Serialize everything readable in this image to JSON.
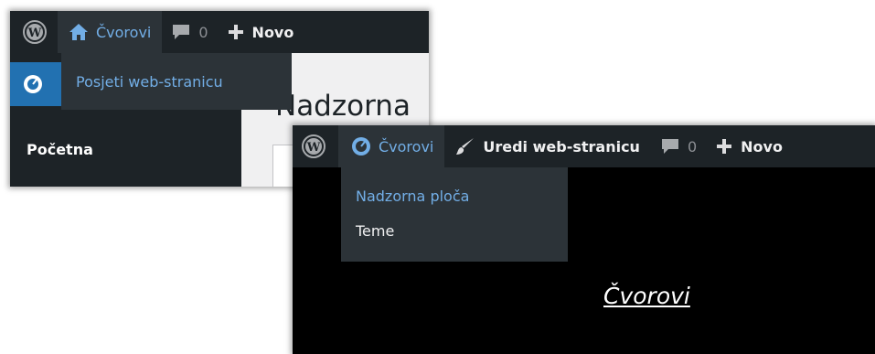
{
  "screenshot1": {
    "adminbar": {
      "site_name": "Čvorovi",
      "comments_count": "0",
      "new_label": "Novo"
    },
    "site_menu": {
      "items": [
        {
          "label": "Posjeti web-stranicu"
        }
      ]
    },
    "sidebar": {
      "pocetna_label": "Početna"
    },
    "page_title": "Nadzorna"
  },
  "screenshot2": {
    "adminbar": {
      "site_name": "Čvorovi",
      "edit_site_label": "Uredi web-stranicu",
      "comments_count": "0",
      "new_label": "Novo"
    },
    "site_menu": {
      "items": [
        {
          "label": "Nadzorna ploča",
          "active": true
        },
        {
          "label": "Teme",
          "active": false
        }
      ]
    },
    "site_title_link": "Čvorovi"
  },
  "colors": {
    "adminbar_bg": "#1d2327",
    "submenu_bg": "#2c3338",
    "accent_blue": "#72aee6",
    "menu_active": "#2271b1"
  }
}
